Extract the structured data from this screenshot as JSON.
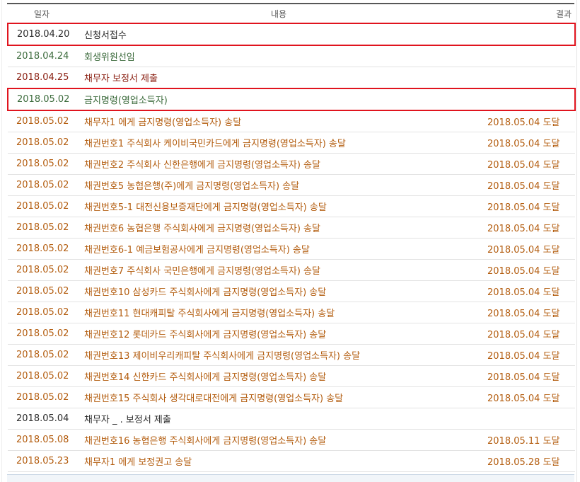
{
  "headers": {
    "date": "일자",
    "content": "내용",
    "result": "결과"
  },
  "rows": [
    {
      "date": "2018.04.20",
      "content": "신청서접수",
      "result": "",
      "tone": "black",
      "highlight": true
    },
    {
      "date": "2018.04.24",
      "content": "회생위원선임",
      "result": "",
      "tone": "green",
      "highlight": false
    },
    {
      "date": "2018.04.25",
      "content": "채무자           보정서 제출",
      "result": "",
      "tone": "red",
      "highlight": false
    },
    {
      "date": "2018.05.02",
      "content": "금지명령(영업소득자)",
      "result": "",
      "tone": "green",
      "highlight": true
    },
    {
      "date": "2018.05.02",
      "content": "채무자1           에게 금지명령(영업소득자) 송달",
      "result": "2018.05.04 도달",
      "tone": "orange",
      "highlight": false
    },
    {
      "date": "2018.05.02",
      "content": "채권번호1 주식회사 케이비국민카드에게 금지명령(영업소득자) 송달",
      "result": "2018.05.04 도달",
      "tone": "orange",
      "highlight": false
    },
    {
      "date": "2018.05.02",
      "content": "채권번호2 주식회사 신한은행에게 금지명령(영업소득자) 송달",
      "result": "2018.05.04 도달",
      "tone": "orange",
      "highlight": false
    },
    {
      "date": "2018.05.02",
      "content": "채권번호5 농협은행(주)에게 금지명령(영업소득자) 송달",
      "result": "2018.05.04 도달",
      "tone": "orange",
      "highlight": false
    },
    {
      "date": "2018.05.02",
      "content": "채권번호5-1 대전신용보증재단에게 금지명령(영업소득자) 송달",
      "result": "2018.05.04 도달",
      "tone": "orange",
      "highlight": false
    },
    {
      "date": "2018.05.02",
      "content": "채권번호6 농협은행 주식회사에게 금지명령(영업소득자) 송달",
      "result": "2018.05.04 도달",
      "tone": "orange",
      "highlight": false
    },
    {
      "date": "2018.05.02",
      "content": "채권번호6-1 예금보험공사에게 금지명령(영업소득자) 송달",
      "result": "2018.05.04 도달",
      "tone": "orange",
      "highlight": false
    },
    {
      "date": "2018.05.02",
      "content": "채권번호7 주식회사 국민은행에게 금지명령(영업소득자) 송달",
      "result": "2018.05.04 도달",
      "tone": "orange",
      "highlight": false
    },
    {
      "date": "2018.05.02",
      "content": "채권번호10 삼성카드 주식회사에게 금지명령(영업소득자) 송달",
      "result": "2018.05.04 도달",
      "tone": "orange",
      "highlight": false
    },
    {
      "date": "2018.05.02",
      "content": "채권번호11 현대캐피탈 주식회사에게 금지명령(영업소득자) 송달",
      "result": "2018.05.04 도달",
      "tone": "orange",
      "highlight": false
    },
    {
      "date": "2018.05.02",
      "content": "채권번호12 롯데카드 주식회사에게 금지명령(영업소득자) 송달",
      "result": "2018.05.04 도달",
      "tone": "orange",
      "highlight": false
    },
    {
      "date": "2018.05.02",
      "content": "채권번호13 제이비우리캐피탈 주식회사에게 금지명령(영업소득자) 송달",
      "result": "2018.05.04 도달",
      "tone": "orange",
      "highlight": false
    },
    {
      "date": "2018.05.02",
      "content": "채권번호14 신한카드 주식회사에게 금지명령(영업소득자) 송달",
      "result": "2018.05.04 도달",
      "tone": "orange",
      "highlight": false
    },
    {
      "date": "2018.05.02",
      "content": "채권번호15 주식회사 생각대로대전에게 금지명령(영업소득자) 송달",
      "result": "2018.05.04 도달",
      "tone": "orange",
      "highlight": false
    },
    {
      "date": "2018.05.04",
      "content": "채무자 _      . 보정서 제출",
      "result": "",
      "tone": "black",
      "highlight": false
    },
    {
      "date": "2018.05.08",
      "content": "채권번호16 농협은행 주식회사에게 금지명령(영업소득자) 송달",
      "result": "2018.05.11 도달",
      "tone": "orange",
      "highlight": false
    },
    {
      "date": "2018.05.23",
      "content": "채무자1           에게 보정권고 송달",
      "result": "2018.05.28 도달",
      "tone": "orange",
      "highlight": false
    }
  ]
}
